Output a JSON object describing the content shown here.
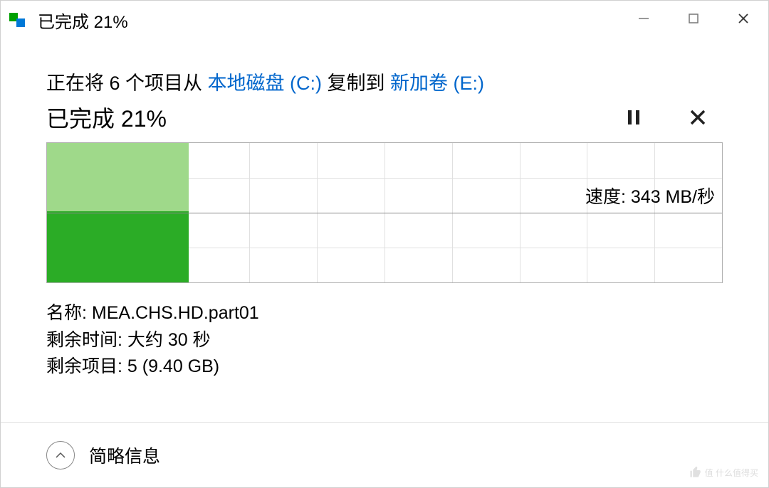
{
  "titlebar": {
    "title": "已完成 21%"
  },
  "copy_line": {
    "prefix": "正在将 6 个项目从 ",
    "source": "本地磁盘 (C:)",
    "middle": " 复制到 ",
    "destination": "新加卷 (E:)"
  },
  "progress": {
    "text": "已完成 21%",
    "percent": 21
  },
  "speed": {
    "label": "速度: 343 MB/秒"
  },
  "details": {
    "name_label": "名称: ",
    "name_value": "MEA.CHS.HD.part01",
    "time_label": "剩余时间: ",
    "time_value": "大约 30 秒",
    "items_label": "剩余项目: ",
    "items_value": "5 (9.40 GB)"
  },
  "footer": {
    "toggle_label": "简略信息"
  },
  "watermark": {
    "text": "值 什么值得买"
  },
  "chart_data": {
    "type": "area",
    "title": "Transfer speed over time",
    "xlabel": "",
    "ylabel": "速度",
    "ylim": [
      0,
      686
    ],
    "x_progress_percent": 21,
    "speed_line_value_mb_s": 343,
    "series": [
      {
        "name": "speed",
        "values": [
          343,
          343,
          343,
          343,
          343,
          343,
          343,
          343,
          343,
          343
        ]
      }
    ]
  }
}
